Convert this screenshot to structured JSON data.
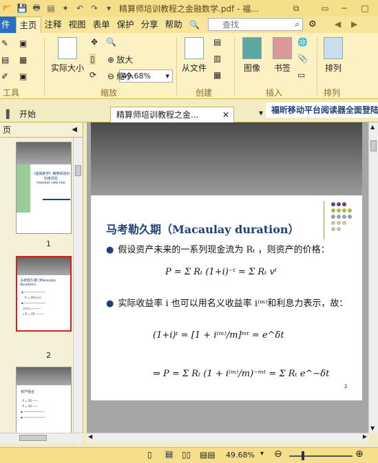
{
  "titlebar": {
    "title": "精算师培训教程之金融数学.pdf - 福..."
  },
  "menu_tabs": [
    {
      "label": "件"
    },
    {
      "label": "主页"
    },
    {
      "label": "注释"
    },
    {
      "label": "视图"
    },
    {
      "label": "表单"
    },
    {
      "label": "保护"
    },
    {
      "label": "分享"
    },
    {
      "label": "帮助"
    }
  ],
  "search": {
    "placeholder": "查找"
  },
  "ribbon": {
    "zoom_value": "49.68%",
    "actual_size": "实际大小",
    "zoom_in": "放大",
    "zoom_out": "缩小",
    "from_file": "从文件",
    "image": "图像",
    "bookmark": "书签",
    "arrange": "排列",
    "groups": {
      "tools": "工具",
      "zoom": "缩放",
      "create": "创建",
      "insert": "插入",
      "arrange": "排列"
    }
  },
  "doc_tabs": {
    "start": "开始",
    "active": "精算师培训教程之金...",
    "ad": "福昕移动平台阅读器全面登陆"
  },
  "pages_panel": {
    "header": "页",
    "thumbs": [
      {
        "num": "1",
        "title_line1": "《金融数学》精算师培训",
        "title_line2": "利率风险",
        "title_line3": "Interest rate risk"
      },
      {
        "num": "2",
        "title_line1": "马考勒久期 (Macaulay duration)"
      },
      {
        "num": "3",
        "title_line1": "资产组合"
      }
    ]
  },
  "slide": {
    "title": "马考勒久期（Macaulay duration）",
    "bullet1": "假设资产未来的一系列现金流为 Rₜ ，则资产的价格：",
    "formula1": "P = Σ Rₜ (1+i)⁻ᵗ = Σ Rₜ vᵗ",
    "bullet2": "实际收益率 i 也可以用名义收益率 i⁽ᵐ⁾和利息力表示，故：",
    "formula2": "(1+i)ᵗ = [1 + i⁽ᵐ⁾/m]ᵐᵗ = e^δt",
    "formula3": "⇒  P = Σ Rₜ (1 + i⁽ᵐ⁾/m)⁻ᵐᵗ = Σ Rₜ e^−δt",
    "page_number": "2"
  },
  "status": {
    "zoom": "49.68%"
  },
  "colors": {
    "accent": "#f6df8a",
    "title_blue": "#1f3f7a",
    "red_arrow": "#d42a2a"
  }
}
